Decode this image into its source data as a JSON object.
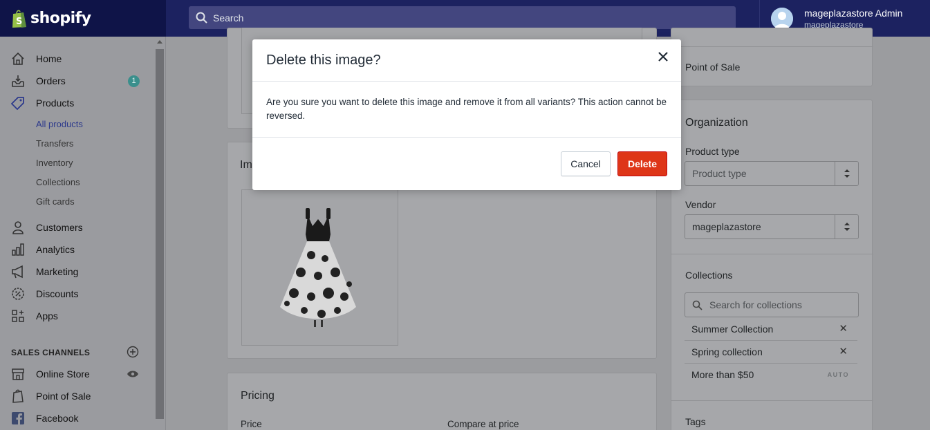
{
  "topbar": {
    "logo_text": "shopify",
    "search_placeholder": "Search",
    "user_name": "mageplazastore Admin",
    "user_store": "mageplazastore"
  },
  "sidebar": {
    "items": [
      {
        "label": "Home",
        "icon": "home-icon"
      },
      {
        "label": "Orders",
        "icon": "orders-icon",
        "badge": "1"
      },
      {
        "label": "Products",
        "icon": "tag-icon"
      },
      {
        "label": "Customers",
        "icon": "person-icon"
      },
      {
        "label": "Analytics",
        "icon": "bar-chart-icon"
      },
      {
        "label": "Marketing",
        "icon": "megaphone-icon"
      },
      {
        "label": "Discounts",
        "icon": "discount-icon"
      },
      {
        "label": "Apps",
        "icon": "apps-icon"
      }
    ],
    "product_subitems": [
      "All products",
      "Transfers",
      "Inventory",
      "Collections",
      "Gift cards"
    ],
    "channels_heading": "SALES CHANNELS",
    "channels": [
      {
        "label": "Online Store",
        "icon": "store-icon"
      },
      {
        "label": "Point of Sale",
        "icon": "pos-icon"
      },
      {
        "label": "Facebook",
        "icon": "facebook-icon"
      }
    ]
  },
  "main": {
    "images_heading_partial": "Im",
    "pricing_heading": "Pricing",
    "price_label": "Price",
    "compare_label": "Compare at price"
  },
  "right": {
    "sales_channel_item": "Point of Sale",
    "organization_heading": "Organization",
    "product_type_label": "Product type",
    "product_type_placeholder": "Product type",
    "vendor_label": "Vendor",
    "vendor_value": "mageplazastore",
    "collections_label": "Collections",
    "collections_search_placeholder": "Search for collections",
    "collections": [
      {
        "name": "Summer Collection",
        "removable": true
      },
      {
        "name": "Spring collection",
        "removable": true
      },
      {
        "name": "More than $50",
        "auto": "AUTO"
      }
    ],
    "tags_label": "Tags"
  },
  "modal": {
    "title": "Delete this image?",
    "body": "Are you sure you want to delete this image and remove it from all variants? This action cannot be reversed.",
    "cancel_label": "Cancel",
    "delete_label": "Delete"
  },
  "colors": {
    "topbar": "#1c2260",
    "delete_button": "#de3618",
    "badge": "#3a8f8c",
    "active_subitem": "#2d3a8c"
  }
}
